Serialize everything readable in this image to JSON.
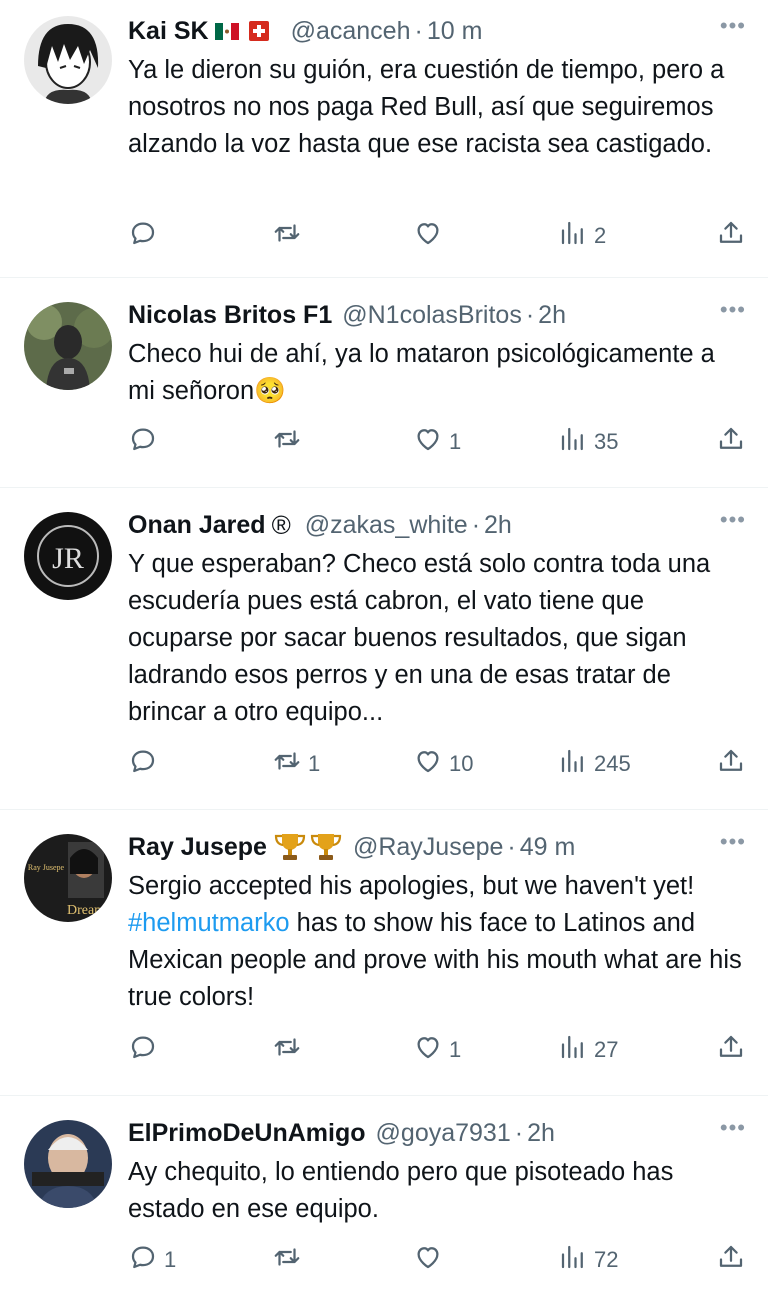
{
  "tweets": [
    {
      "name": "Kai SK",
      "badges": [
        "🇲🇽",
        "🇨🇭"
      ],
      "handle": "@acanceh",
      "time": "10 m",
      "text": "Ya le dieron su guión, era cuestión de tiempo, pero a nosotros no nos paga Red Bull, así que seguiremos alzando la voz hasta que ese racista sea castigado.",
      "replies": "",
      "retweets": "",
      "likes": "",
      "views": "2"
    },
    {
      "name": "Nicolas Britos F1",
      "badges": [],
      "handle": "@N1colasBritos",
      "time": "2h",
      "text": "Checo hui de ahí, ya lo mataron psicológicamente a mi señoron🥺",
      "replies": "",
      "retweets": "",
      "likes": "1",
      "views": "35"
    },
    {
      "name": "Onan Jared",
      "badges": [
        "®"
      ],
      "handle": "@zakas_white",
      "time": "2h",
      "text": "Y que esperaban? Checo está solo contra toda una escudería pues está cabron, el vato tiene que ocuparse por sacar buenos resultados, que sigan ladrando esos perros y en una de esas tratar de brincar a otro equipo...",
      "replies": "",
      "retweets": "1",
      "likes": "10",
      "views": "245"
    },
    {
      "name": "Ray Jusepe",
      "badges": [
        "🏆",
        "🏆"
      ],
      "handle": "@RayJusepe",
      "time": "49 m",
      "text_before": "Sergio accepted his apologies, but we haven't yet! ",
      "hashtag": "#helmutmarko",
      "text_after": " has to show his face to Latinos and Mexican people and prove with his mouth what are his true colors!",
      "replies": "",
      "retweets": "",
      "likes": "1",
      "views": "27"
    },
    {
      "name": "ElPrimoDeUnAmigo",
      "badges": [],
      "handle": "@goya7931",
      "time": "2h",
      "text": "Ay chequito, lo entiendo pero que pisoteado has estado en ese equipo.",
      "replies": "1",
      "retweets": "",
      "likes": "",
      "views": "72"
    }
  ],
  "separator": "·",
  "more_glyph": "•••",
  "icons": {
    "reply": "reply-icon",
    "retweet": "retweet-icon",
    "like": "heart-icon",
    "views": "views-icon",
    "share": "share-icon"
  },
  "colors": {
    "text": "#0f1419",
    "secondary": "#536471",
    "link": "#1d9bf0",
    "divider": "#eff3f4"
  }
}
